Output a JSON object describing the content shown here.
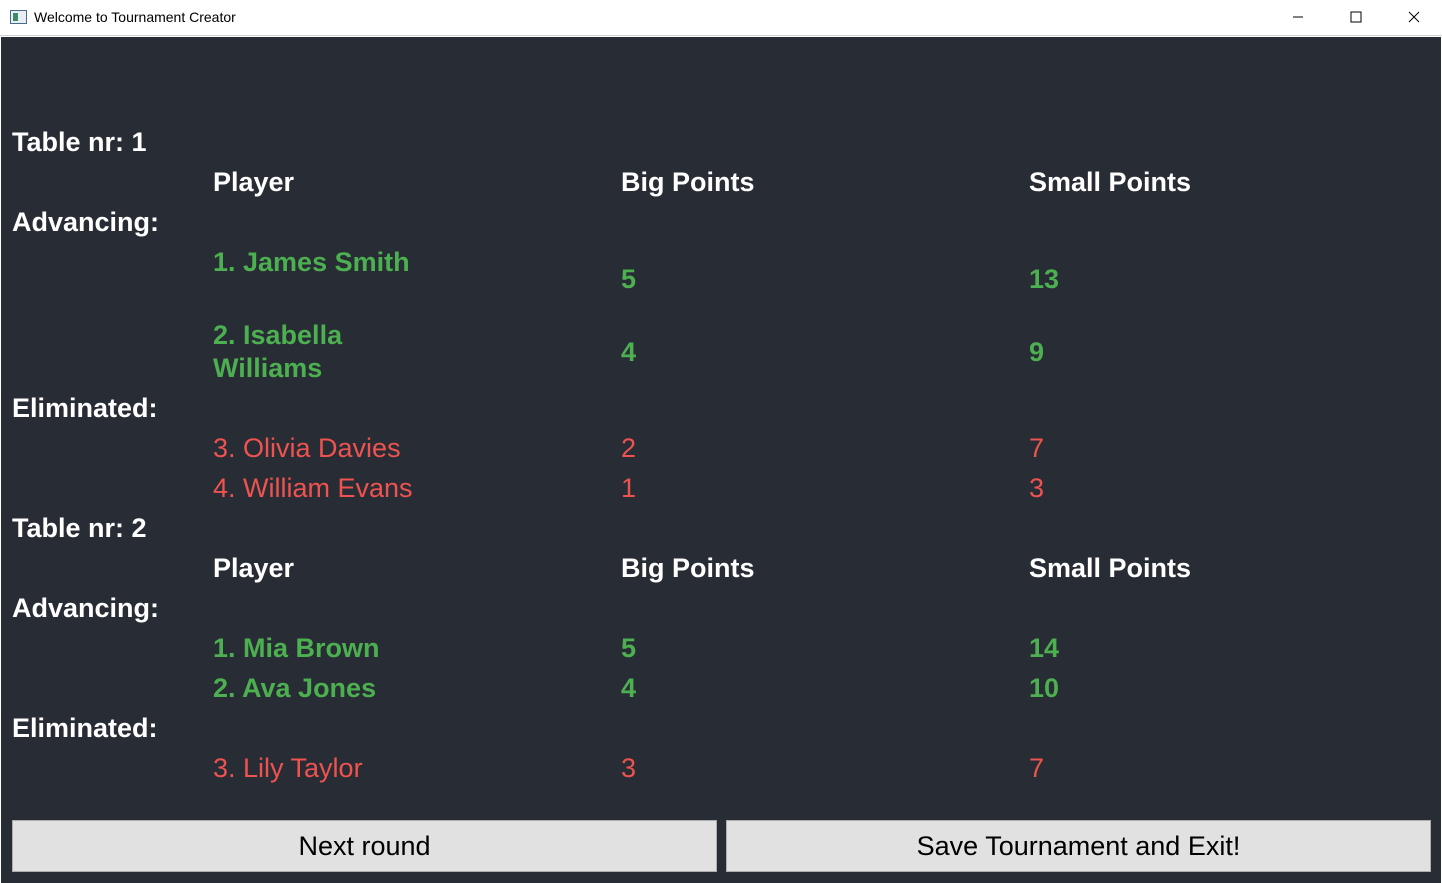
{
  "window": {
    "title": "Welcome to Tournament Creator"
  },
  "tables": [
    {
      "label": "Table nr: 1",
      "headers": {
        "player": "Player",
        "big": "Big Points",
        "small": "Small Points"
      },
      "advancing_label": "Advancing:",
      "advancing": [
        {
          "player": "1. James Smith",
          "big": "5",
          "small": "13"
        },
        {
          "player": "2. Isabella Williams",
          "big": "4",
          "small": "9"
        }
      ],
      "eliminated_label": "Eliminated:",
      "eliminated": [
        {
          "player": "3. Olivia Davies",
          "big": "2",
          "small": "7"
        },
        {
          "player": "4. William Evans",
          "big": "1",
          "small": "3"
        }
      ]
    },
    {
      "label": "Table nr: 2",
      "headers": {
        "player": "Player",
        "big": "Big Points",
        "small": "Small Points"
      },
      "advancing_label": "Advancing:",
      "advancing": [
        {
          "player": "1. Mia Brown",
          "big": "5",
          "small": "14"
        },
        {
          "player": "2. Ava Jones",
          "big": "4",
          "small": "10"
        }
      ],
      "eliminated_label": "Eliminated:",
      "eliminated": [
        {
          "player": "3. Lily Taylor",
          "big": "3",
          "small": "7"
        }
      ]
    }
  ],
  "buttons": {
    "next_round": "Next round",
    "save_exit": "Save Tournament and Exit!"
  },
  "colors": {
    "background": "#282c34",
    "advancing": "#4caf50",
    "eliminated": "#ef5350",
    "label": "#ffffff"
  }
}
